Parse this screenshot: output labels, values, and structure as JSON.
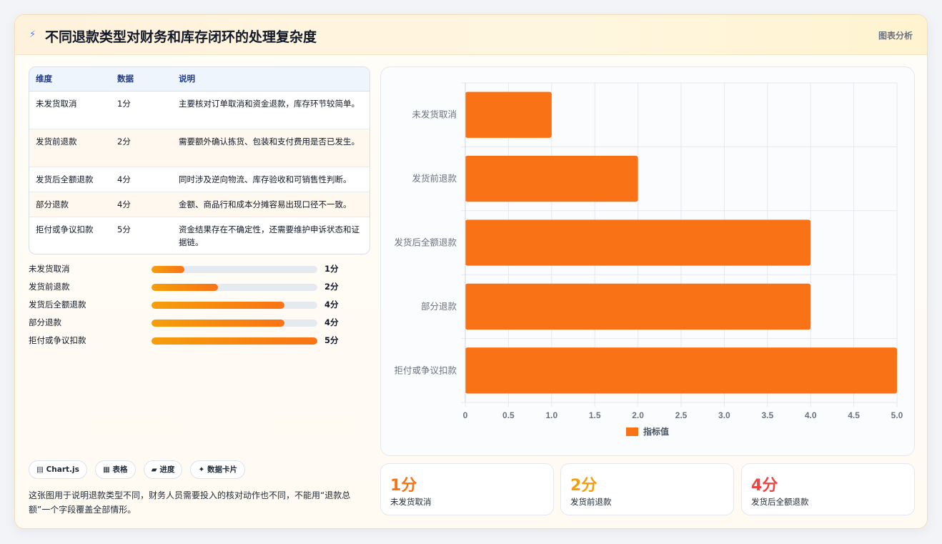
{
  "header": {
    "icon": "⚡",
    "title": "不同退款类型对财务和库存闭环的处理复杂度",
    "tag": "图表分析"
  },
  "table": {
    "headers": [
      "维度",
      "数据",
      "说明"
    ],
    "rows": [
      [
        "未发货取消",
        "1分",
        "主要核对订单取消和资金退款，库存环节较简单。"
      ],
      [
        "发货前退款",
        "2分",
        "需要额外确认拣货、包装和支付费用是否已发生。"
      ],
      [
        "发货后全额退款",
        "4分",
        "同时涉及逆向物流、库存验收和可销售性判断。"
      ],
      [
        "部分退款",
        "4分",
        "金额、商品行和成本分摊容易出现口径不一致。"
      ],
      [
        "拒付或争议扣款",
        "5分",
        "资金结果存在不确定性，还需要维护申诉状态和证据链。"
      ]
    ]
  },
  "progress": [
    {
      "label": "未发货取消",
      "value": 1,
      "text": "1分"
    },
    {
      "label": "发货前退款",
      "value": 2,
      "text": "2分"
    },
    {
      "label": "发货后全额退款",
      "value": 4,
      "text": "4分"
    },
    {
      "label": "部分退款",
      "value": 4,
      "text": "4分"
    },
    {
      "label": "拒付或争议扣款",
      "value": 5,
      "text": "5分"
    }
  ],
  "chips": [
    "▤ Chart.js",
    "▦ 表格",
    "▰ 进度",
    "✦ 数据卡片"
  ],
  "note": "这张图用于说明退款类型不同，财务人员需要投入的核对动作也不同，不能用“退款总额”一个字段覆盖全部情形。",
  "kpis": [
    {
      "value": "1分",
      "label": "未发货取消",
      "color": "#f97316"
    },
    {
      "value": "2分",
      "label": "发货前退款",
      "color": "#f59e0b"
    },
    {
      "value": "4分",
      "label": "发货后全额退款",
      "color": "#ef4444"
    }
  ],
  "chart_data": {
    "type": "bar",
    "orientation": "horizontal",
    "categories": [
      "未发货取消",
      "发货前退款",
      "发货后全额退款",
      "部分退款",
      "拒付或争议扣款"
    ],
    "series": [
      {
        "name": "指标值",
        "values": [
          1,
          2,
          4,
          4,
          5
        ],
        "color": "#f97316"
      }
    ],
    "xlim": [
      0,
      5
    ],
    "xticks": [
      "0",
      "0.5",
      "1.0",
      "1.5",
      "2.0",
      "2.5",
      "3.0",
      "3.5",
      "4.0",
      "4.5",
      "5.0"
    ],
    "grid": true,
    "legend": "bottom"
  }
}
